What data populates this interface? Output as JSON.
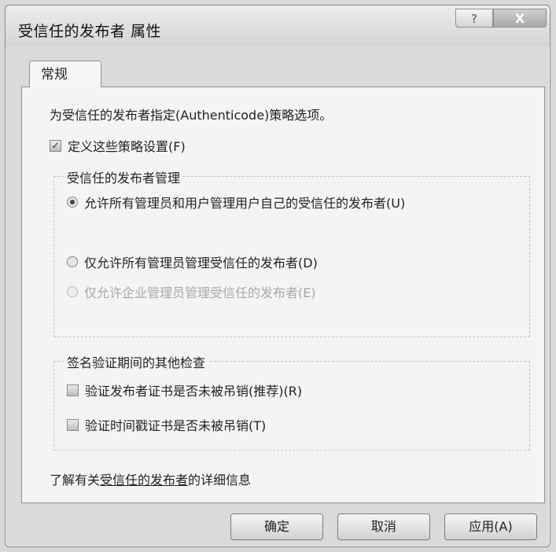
{
  "window": {
    "title": "受信任的发布者 属性",
    "help_label": "?",
    "close_label": "X"
  },
  "tabs": [
    {
      "label": "常规"
    }
  ],
  "description": "为受信任的发布者指定(Authenticode)策略选项。",
  "define_policy": {
    "label": "定义这些策略设置(F)",
    "checked": true,
    "mark": "✓"
  },
  "management_group": {
    "legend": "受信任的发布者管理",
    "options": [
      {
        "label": "允许所有管理员和用户管理用户自己的受信任的发布者(U)",
        "checked": true,
        "enabled": true
      },
      {
        "label": "仅允许所有管理员管理受信任的发布者(D)",
        "checked": false,
        "enabled": true
      },
      {
        "label": "仅允许企业管理员管理受信任的发布者(E)",
        "checked": false,
        "enabled": false
      }
    ]
  },
  "verification_group": {
    "legend": "签名验证期间的其他检查",
    "checks": [
      {
        "label": "验证发布者证书是否未被吊销(推荐)(R)",
        "checked": false
      },
      {
        "label": "验证时间戳证书是否未被吊销(T)",
        "checked": false
      }
    ]
  },
  "info": {
    "prefix": "了解有关",
    "link": "受信任的发布者",
    "suffix": "的详细信息"
  },
  "buttons": {
    "ok": "确定",
    "cancel": "取消",
    "apply": "应用(A)"
  }
}
